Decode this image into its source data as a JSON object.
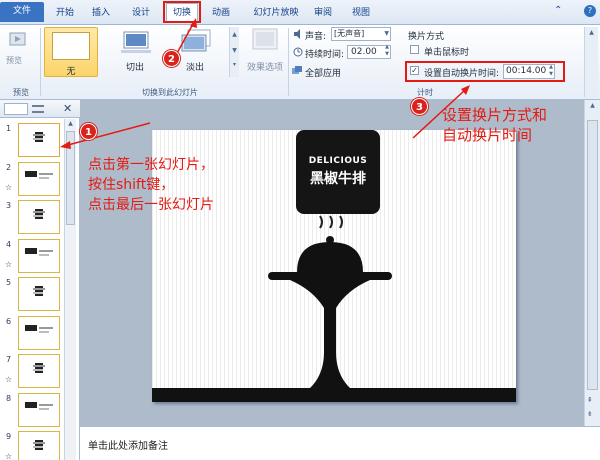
{
  "tabs": {
    "file": "文件",
    "home": "开始",
    "insert": "插入",
    "design": "设计",
    "transition": "切换",
    "animation": "动画",
    "slideshow": "幻灯片放映",
    "review": "审阅",
    "view": "视图"
  },
  "ribbon": {
    "preview_label": "预览",
    "preview_group": "预览",
    "none_label": "无",
    "cut_label": "切出",
    "fade_label": "淡出",
    "effects_label": "效果选项",
    "transition_group": "切换到此幻灯片",
    "sound_label": "声音:",
    "sound_value": "[无声音]",
    "duration_label": "持续时间:",
    "duration_value": "02.00",
    "apply_all": "全部应用",
    "advance_title": "换片方式",
    "on_click": "单击鼠标时",
    "auto_after": "设置自动换片时间:",
    "auto_time": "00:14.00",
    "timing_group": "计时"
  },
  "slides": [
    {
      "num": "1",
      "star": ""
    },
    {
      "num": "2",
      "star": "☆"
    },
    {
      "num": "3",
      "star": ""
    },
    {
      "num": "4",
      "star": "☆"
    },
    {
      "num": "5",
      "star": ""
    },
    {
      "num": "6",
      "star": ""
    },
    {
      "num": "7",
      "star": "☆"
    },
    {
      "num": "8",
      "star": ""
    },
    {
      "num": "9",
      "star": "☆"
    }
  ],
  "slide": {
    "logo_en": "DELICIOUS",
    "logo_cn": "黑椒牛排"
  },
  "notes_placeholder": "单击此处添加备注",
  "annotations": {
    "step1": "点击第一张幻灯片，\n按住shift键，\n点击最后一张幻灯片",
    "step3": "设置换片方式和\n自动换片时间",
    "n1": "1",
    "n2": "2",
    "n3": "3"
  },
  "colors": {
    "accent": "#d9221c",
    "ribbon_blue": "#15428b",
    "file_tab": "#3b73c3"
  }
}
